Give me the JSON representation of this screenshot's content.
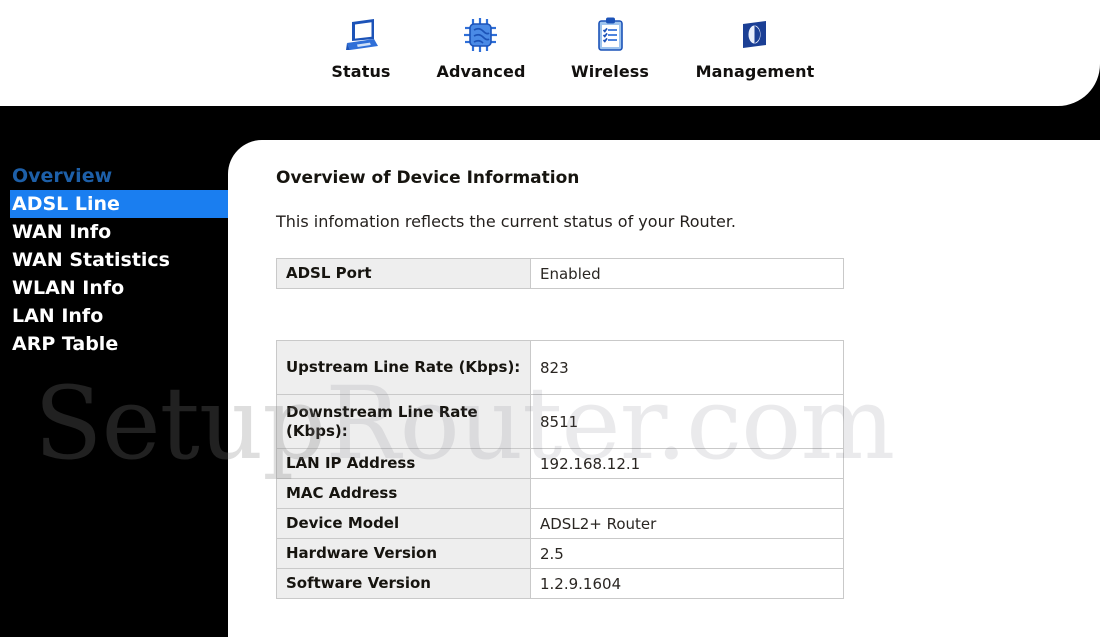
{
  "header": {
    "nav": [
      {
        "label": "Status",
        "icon": "laptop-icon"
      },
      {
        "label": "Advanced",
        "icon": "cpu-chip-icon"
      },
      {
        "label": "Wireless",
        "icon": "clipboard-checklist-icon"
      },
      {
        "label": "Management",
        "icon": "flag-book-icon"
      }
    ]
  },
  "sidebar": {
    "items": [
      {
        "label": "Overview",
        "state": "dim"
      },
      {
        "label": "ADSL Line",
        "state": "active"
      },
      {
        "label": "WAN Info",
        "state": "normal"
      },
      {
        "label": "WAN Statistics",
        "state": "normal"
      },
      {
        "label": "WLAN Info",
        "state": "normal"
      },
      {
        "label": "LAN Info",
        "state": "normal"
      },
      {
        "label": "ARP Table",
        "state": "normal"
      }
    ]
  },
  "main": {
    "title": "Overview of Device Information",
    "subtitle": "This infomation reflects the current status of your Router.",
    "port_table": {
      "rows": [
        {
          "key": "ADSL Port",
          "value": "Enabled"
        }
      ]
    },
    "device_table": {
      "rows": [
        {
          "key": "Upstream Line Rate (Kbps):",
          "value": "823"
        },
        {
          "key": "Downstream Line Rate (Kbps):",
          "value": "8511"
        },
        {
          "key": "LAN IP Address",
          "value": "192.168.12.1"
        },
        {
          "key": "MAC Address",
          "value": ""
        },
        {
          "key": "Device Model",
          "value": "ADSL2+ Router"
        },
        {
          "key": "Hardware Version",
          "value": "2.5"
        },
        {
          "key": "Software Version",
          "value": "1.2.9.1604"
        }
      ]
    }
  },
  "watermark": {
    "part_dark": "Setup",
    "part_light": "Router.com"
  },
  "colors": {
    "accent_blue": "#1a7ef0",
    "dim_blue": "#1d5fa8",
    "sidebar_bg": "#000000",
    "panel_bg": "#ffffff",
    "table_key_bg": "#eeeeee",
    "table_border": "#c9c9c9"
  }
}
